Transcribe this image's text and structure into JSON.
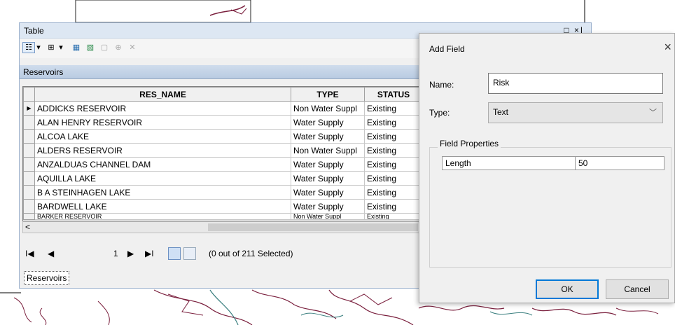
{
  "table_window": {
    "title": "Table",
    "title_controls": "□ ×|",
    "toolbar_icons": [
      "table-options-icon",
      "related-tables-icon",
      "select-by-attributes-icon",
      "switch-selection-icon",
      "clear-selection-icon",
      "zoom-to-selected-icon",
      "delete-selected-icon"
    ],
    "tab_name": "Reservoirs",
    "columns": [
      "RES_NAME",
      "TYPE",
      "STATUS"
    ],
    "rows": [
      {
        "marker": "▶",
        "res_name": "ADDICKS RESERVOIR",
        "type": "Non Water Suppl",
        "status": "Existing"
      },
      {
        "marker": "",
        "res_name": "ALAN HENRY RESERVOIR",
        "type": "Water Supply",
        "status": "Existing"
      },
      {
        "marker": "",
        "res_name": "ALCOA LAKE",
        "type": "Water Supply",
        "status": "Existing"
      },
      {
        "marker": "",
        "res_name": "ALDERS RESERVOIR",
        "type": "Non Water Suppl",
        "status": "Existing"
      },
      {
        "marker": "",
        "res_name": "ANZALDUAS CHANNEL DAM",
        "type": "Water Supply",
        "status": "Existing"
      },
      {
        "marker": "",
        "res_name": "AQUILLA LAKE",
        "type": "Water Supply",
        "status": "Existing"
      },
      {
        "marker": "",
        "res_name": "B A STEINHAGEN LAKE",
        "type": "Water Supply",
        "status": "Existing"
      },
      {
        "marker": "",
        "res_name": "BARDWELL LAKE",
        "type": "Water Supply",
        "status": "Existing"
      },
      {
        "marker": "",
        "res_name": "BARKER RESERVOIR",
        "type": "Non Water Suppl",
        "status": "Existing"
      }
    ],
    "nav": {
      "first": "I◀",
      "prev": "◀",
      "record": "1",
      "next": "▶",
      "last": "▶I",
      "selection": "(0 out of 211 Selected)"
    },
    "bottom_tab": "Reservoirs"
  },
  "dialog": {
    "title": "Add Field",
    "close": "×",
    "name_label": "Name:",
    "name_value": "Risk",
    "type_label": "Type:",
    "type_value": "Text",
    "field_properties_label": "Field Properties",
    "property_key": "Length",
    "property_value": "50",
    "ok_label": "OK",
    "cancel_label": "Cancel"
  },
  "colors": {
    "map_lines": "#7a1f3d",
    "map_water": "#3a7f7f",
    "title_bar": "#dde7f3",
    "accent": "#0078d7"
  }
}
